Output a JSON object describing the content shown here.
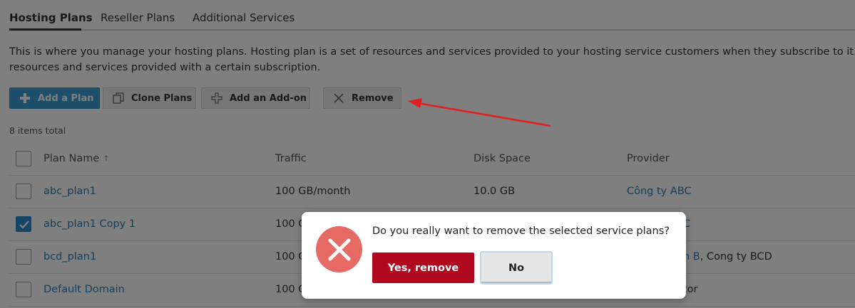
{
  "tabs": [
    {
      "label": "Hosting Plans",
      "active": true
    },
    {
      "label": "Reseller Plans",
      "active": false
    },
    {
      "label": "Additional Services",
      "active": false
    }
  ],
  "description": {
    "line1": "This is where you manage your hosting plans. Hosting plan is a set of resources and services provided to your hosting service customers when they subscribe to it. The",
    "line2": "resources and services provided with a certain subscription."
  },
  "toolbar": {
    "add_plan": "Add a Plan",
    "clone_plans": "Clone Plans",
    "add_addon": "Add an Add-on",
    "remove": "Remove"
  },
  "items_total": "8 items total",
  "table": {
    "columns": {
      "plan_name": "Plan Name",
      "sort_indicator": "↑",
      "traffic": "Traffic",
      "disk_space": "Disk Space",
      "provider": "Provider"
    },
    "rows": [
      {
        "plan_name": "abc_plan1",
        "traffic": "100 GB/month",
        "disk_space": "10.0 GB",
        "provider": "Công ty ABC",
        "checked": false
      },
      {
        "plan_name": "abc_plan1 Copy 1",
        "traffic": "100 G",
        "disk_space": "",
        "provider": "C",
        "checked": true
      },
      {
        "plan_name": "bcd_plan1",
        "traffic": "100 G",
        "disk_space": "",
        "provider_link": "n B",
        "provider_rest": ", Cong ty BCD",
        "checked": false
      },
      {
        "plan_name": "Default Domain",
        "traffic": "100 G",
        "disk_space": "",
        "provider": "tor",
        "checked": false
      }
    ]
  },
  "dialog": {
    "message": "Do you really want to remove the selected service plans?",
    "confirm_label": "Yes, remove",
    "cancel_label": "No"
  },
  "colors": {
    "primary": "#3b9fd6",
    "link": "#2a7fb4",
    "danger": "#b0091f",
    "error_icon": "#e66a64",
    "annotation_arrow": "#e0201e"
  }
}
